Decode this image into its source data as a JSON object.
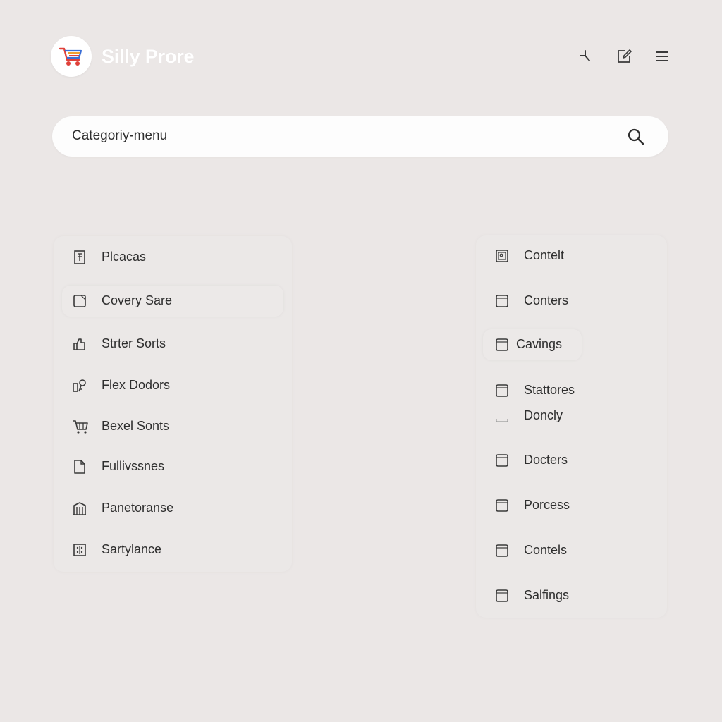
{
  "header": {
    "brand": "Silly Prore",
    "icons": [
      "cart-icon",
      "tool-icon",
      "edit-icon",
      "menu-icon"
    ]
  },
  "search": {
    "value": "Categoriy-menu",
    "placeholder": "Categoriy-menu",
    "icon": "search-icon"
  },
  "left_menu": {
    "items": [
      {
        "label": "Plcacas",
        "icon": "grid-doc-icon"
      },
      {
        "label": "Covery Sare",
        "icon": "square-icon"
      },
      {
        "label": "Strter Sorts",
        "icon": "hand-icon"
      },
      {
        "label": "Flex Dodors",
        "icon": "key-icon"
      },
      {
        "label": "Bexel Sonts",
        "icon": "cart-icon"
      },
      {
        "label": "Fullivssnes",
        "icon": "file-icon"
      },
      {
        "label": "Panetoranse",
        "icon": "building-icon"
      },
      {
        "label": "Sartylance",
        "icon": "calculator-icon"
      }
    ]
  },
  "right_menu": {
    "items": [
      {
        "label": "Contelt",
        "icon": "image-box-icon"
      },
      {
        "label": "Conters",
        "icon": "square-icon"
      },
      {
        "label": "Cavings",
        "icon": "square-icon"
      },
      {
        "label": "Stattores",
        "icon": "square-icon"
      },
      {
        "label": "Doncly",
        "icon": "tray-icon"
      },
      {
        "label": "Docters",
        "icon": "square-icon"
      },
      {
        "label": "Porcess",
        "icon": "square-icon"
      },
      {
        "label": "Contels",
        "icon": "square-icon"
      },
      {
        "label": "Salfings",
        "icon": "square-icon"
      }
    ]
  },
  "colors": {
    "background": "#ebe7e6",
    "panel": "#ebe8e7",
    "search_bg": "#fdfdfd",
    "text": "#2e2e2e",
    "icon_stroke": "#3a3a3a",
    "cart_red": "#e0413a",
    "cart_blue": "#3b6fd6",
    "cart_orange": "#f0a030"
  }
}
